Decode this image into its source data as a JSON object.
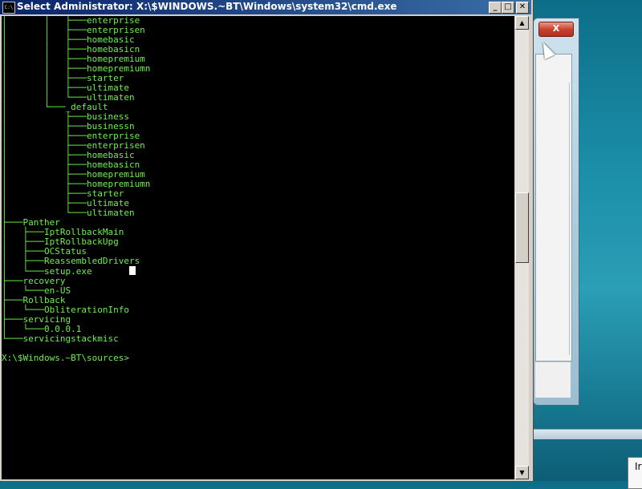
{
  "window": {
    "title": "Select Administrator: X:\\$WINDOWS.~BT\\Windows\\system32\\cmd.exe",
    "icon_text": "C:\\",
    "minimize_glyph": "_",
    "maximize_glyph": "□",
    "close_glyph": "✕"
  },
  "background_dialog": {
    "close_glyph": "X",
    "partial_text": "Ir"
  },
  "console": {
    "lines": [
      "│       │   ├───enterprise",
      "│       │   ├───enterprisen",
      "│       │   ├───homebasic",
      "│       │   ├───homebasicn",
      "│       │   ├───homepremium",
      "│       │   ├───homepremiumn",
      "│       │   ├───starter",
      "│       │   ├───ultimate",
      "│       │   └───ultimaten",
      "│       └───_default",
      "│           ├───business",
      "│           ├───businessn",
      "│           ├───enterprise",
      "│           ├───enterprisen",
      "│           ├───homebasic",
      "│           ├───homebasicn",
      "│           ├───homepremium",
      "│           ├───homepremiumn",
      "│           ├───starter",
      "│           ├───ultimate",
      "│           └───ultimaten",
      "├───Panther",
      "│   ├───IptRollbackMain",
      "│   ├───IptRollbackUpg",
      "│   ├───OCStatus",
      "│   ├───ReassembledDrivers",
      "│   └───setup.exe",
      "├───recovery",
      "│   └───en-US",
      "├───Rollback",
      "│   └───ObliterationInfo",
      "├───servicing",
      "│   └───0.0.0.1",
      "└───servicingstackmisc",
      "",
      "X:\\$Windows.~BT\\sources>"
    ]
  },
  "scrollbar": {
    "up_glyph": "▲",
    "down_glyph": "▼"
  }
}
